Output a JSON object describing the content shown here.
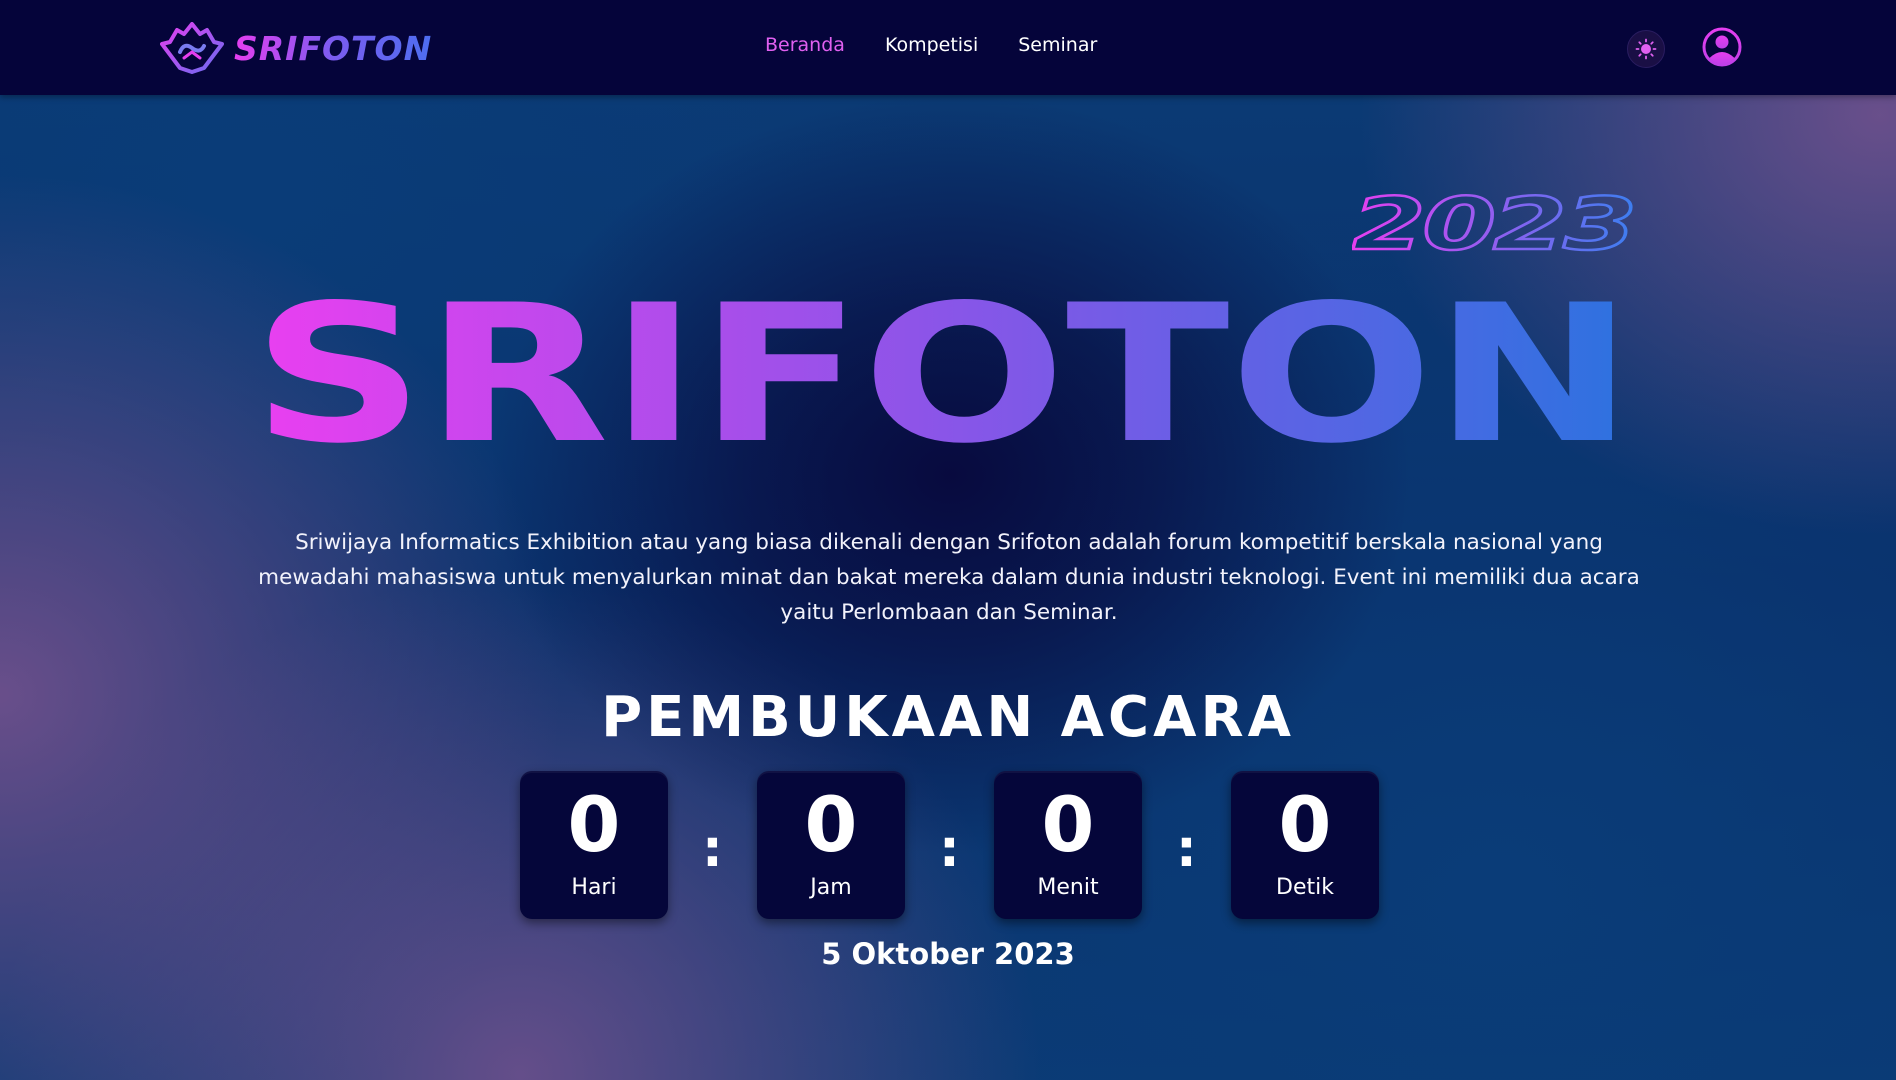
{
  "navbar": {
    "brand": "SRIFOTON",
    "links": [
      {
        "label": "Beranda",
        "active": true
      },
      {
        "label": "Kompetisi",
        "active": false
      },
      {
        "label": "Seminar",
        "active": false
      }
    ],
    "theme_toggle_icon": "sun-icon",
    "user_icon": "user-circle-icon"
  },
  "hero": {
    "year": "2023",
    "title": "SRIFOTON",
    "description": "Sriwijaya Informatics Exhibition atau yang biasa dikenali dengan Srifoton adalah forum kompetitif berskala nasional yang mewadahi mahasiswa untuk menyalurkan minat dan bakat mereka dalam dunia industri teknologi. Event ini memiliki dua acara yaitu Perlombaan dan Seminar."
  },
  "countdown": {
    "title": "PEMBUKAAN ACARA",
    "units": [
      {
        "value": "0",
        "label": "Hari"
      },
      {
        "value": "0",
        "label": "Jam"
      },
      {
        "value": "0",
        "label": "Menit"
      },
      {
        "value": "0",
        "label": "Detik"
      }
    ],
    "separator": ":",
    "date": "5 Oktober 2023"
  },
  "colors": {
    "navbar_bg": "#05043a",
    "accent_pink": "#e63ef0",
    "accent_blue": "#2f6fe0",
    "active_link": "#e060f0",
    "countdown_box": "#05063a"
  }
}
